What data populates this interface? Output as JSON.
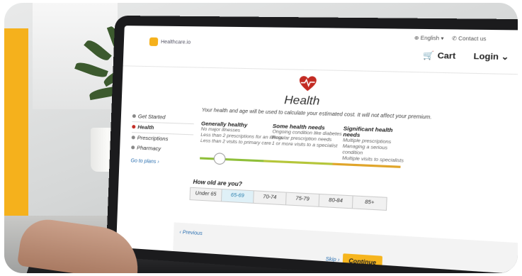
{
  "header": {
    "logo_text": "Healthcare.io",
    "language": "English",
    "contact": "Contact us",
    "cart_label": "Cart",
    "login_label": "Login"
  },
  "page": {
    "title": "Health",
    "subtitle": "Your health and age will be used to calculate your estimated cost. It will not affect your premium."
  },
  "sidenav": {
    "items": [
      {
        "label": "Get Started"
      },
      {
        "label": "Health"
      },
      {
        "label": "Prescriptions"
      },
      {
        "label": "Pharmacy"
      }
    ],
    "goto_label": "Go to plans"
  },
  "needs": [
    {
      "title": "Generally healthy",
      "lines": [
        "No major illnesses",
        "Less than 2 prescriptions for an illness",
        "Less than 2 visits to primary care"
      ]
    },
    {
      "title": "Some health needs",
      "lines": [
        "Ongoing condition like diabetes",
        "Regular prescription needs",
        "1 or more visits to a specialist"
      ]
    },
    {
      "title": "Significant health needs",
      "lines": [
        "Multiple prescriptions",
        "Managing a serious condition",
        "Multiple visits to specialists"
      ]
    }
  ],
  "slider": {
    "value": 0.1
  },
  "age": {
    "question": "How old are you?",
    "options": [
      "Under 65",
      "65-69",
      "70-74",
      "75-79",
      "80-84",
      "85+"
    ],
    "selected": "65-69"
  },
  "footer": {
    "prev_label": "Previous",
    "skip_label": "Skip",
    "continue_label": "Continue"
  },
  "colors": {
    "accent": "#f5b11c",
    "active_dot": "#c32b23",
    "link": "#2a6fb0",
    "selected_age_bg": "#dff0f7"
  }
}
